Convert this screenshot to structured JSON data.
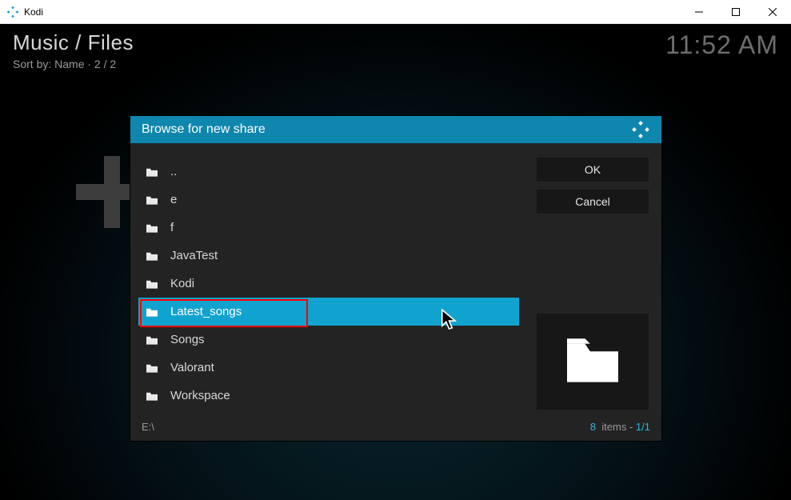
{
  "window": {
    "app_name": "Kodi"
  },
  "kodi": {
    "breadcrumb": "Music / Files",
    "sort_line": "Sort by: Name  ·  2 / 2",
    "clock": "11:52 AM"
  },
  "dialog": {
    "title": "Browse for new share",
    "ok_label": "OK",
    "cancel_label": "Cancel",
    "path": "E:\\",
    "items_word": "items",
    "item_count": "8",
    "page_pos": "1/1",
    "folders": [
      {
        "name": "..",
        "selected": false
      },
      {
        "name": "e",
        "selected": false
      },
      {
        "name": "f",
        "selected": false
      },
      {
        "name": "JavaTest",
        "selected": false
      },
      {
        "name": "Kodi",
        "selected": false
      },
      {
        "name": "Latest_songs",
        "selected": true
      },
      {
        "name": "Songs",
        "selected": false
      },
      {
        "name": "Valorant",
        "selected": false
      },
      {
        "name": "Workspace",
        "selected": false
      }
    ]
  }
}
